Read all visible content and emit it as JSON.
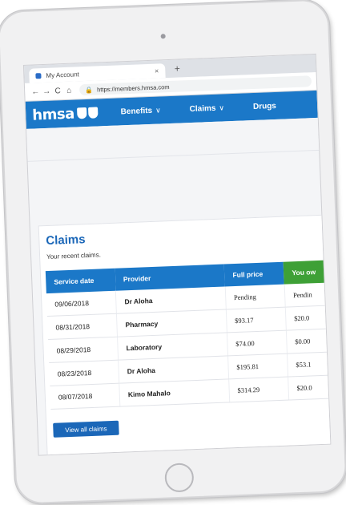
{
  "browser": {
    "tab_title": "My Account",
    "tab_close": "×",
    "new_tab": "+",
    "url": "https://members.hmsa.com",
    "nav": {
      "back": "←",
      "forward": "→",
      "reload": "C",
      "home": "⌂",
      "lock": "🔒"
    }
  },
  "site": {
    "logo": "hmsa",
    "menu": [
      {
        "label": "Benefits",
        "chevron": "∨"
      },
      {
        "label": "Claims",
        "chevron": "∨"
      },
      {
        "label": "Drugs",
        "chevron": ""
      }
    ]
  },
  "claims": {
    "title": "Claims",
    "subtitle": "Your recent claims.",
    "columns": [
      "Service date",
      "Provider",
      "Full price",
      "You ow"
    ],
    "rows": [
      {
        "date": "09/06/2018",
        "provider": "Dr Aloha",
        "full_price": "Pending",
        "you_owe": "Pendin"
      },
      {
        "date": "08/31/2018",
        "provider": "Pharmacy",
        "full_price": "$93.17",
        "you_owe": "$20.0"
      },
      {
        "date": "08/29/2018",
        "provider": "Laboratory",
        "full_price": "$74.00",
        "you_owe": "$0.00"
      },
      {
        "date": "08/23/2018",
        "provider": "Dr Aloha",
        "full_price": "$195.81",
        "you_owe": "$53.1"
      },
      {
        "date": "08/07/2018",
        "provider": "Kimo Mahalo",
        "full_price": "$314.29",
        "you_owe": "$20.0"
      }
    ],
    "view_all_label": "View all claims"
  }
}
